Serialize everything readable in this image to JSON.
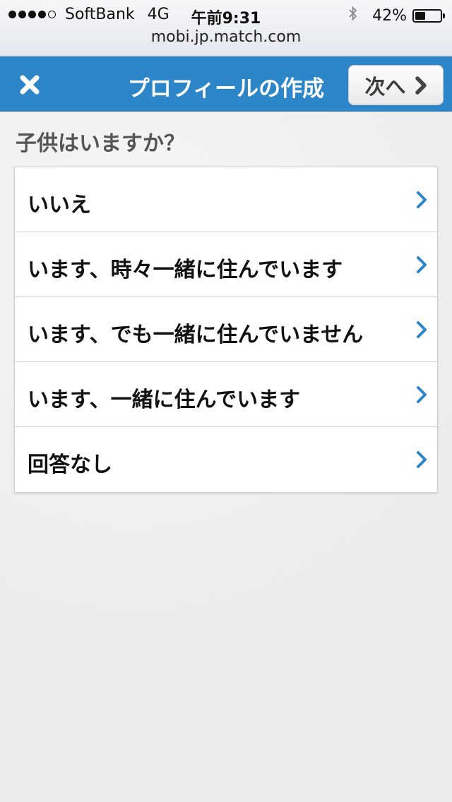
{
  "status_bar": {
    "carrier": "SoftBank",
    "network": "4G",
    "time": "午前9:31",
    "battery_percent_text": "42%",
    "battery_level": 0.42,
    "url": "mobi.jp.match.com"
  },
  "nav": {
    "title": "プロフィールの作成",
    "next_label": "次へ"
  },
  "question": "子供はいますか？",
  "options": [
    {
      "label": "いいえ"
    },
    {
      "label": "います、時々一緒に住んでいます"
    },
    {
      "label": "います、でも一緒に住んでいません"
    },
    {
      "label": "います、一緒に住んでいます"
    },
    {
      "label": "回答なし"
    }
  ],
  "colors": {
    "nav_blue": "#2d86c8",
    "chevron_blue": "#2d86c8"
  }
}
